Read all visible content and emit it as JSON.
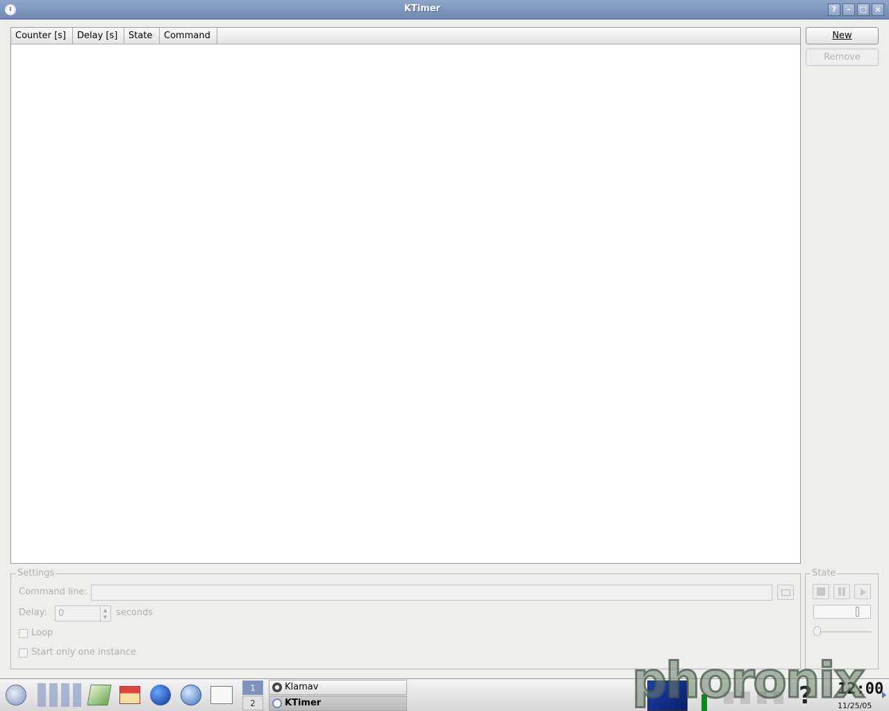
{
  "window": {
    "title": "KTimer",
    "controls": [
      "?",
      "–",
      "□",
      "×"
    ]
  },
  "list": {
    "columns": [
      "Counter [s]",
      "Delay [s]",
      "State",
      "Command"
    ]
  },
  "buttons": {
    "new_label": "New",
    "remove_label": "Remove"
  },
  "settings": {
    "legend": "Settings",
    "command_line_label": "Command line:",
    "command_line_value": "",
    "delay_label": "Delay:",
    "delay_value": "0",
    "seconds_label": "seconds",
    "loop_label": "Loop",
    "one_instance_label": "Start only one instance"
  },
  "state": {
    "legend": "State",
    "progress": 0
  },
  "taskbar": {
    "desktops": [
      "1",
      "2"
    ],
    "tasks": [
      "Klamav",
      "KTimer"
    ],
    "date": "11/25/05",
    "time": "12:00",
    "watermark": "phoronix"
  },
  "colors": {
    "titlebar": "#7890b8",
    "accent": "#5a73a0"
  }
}
